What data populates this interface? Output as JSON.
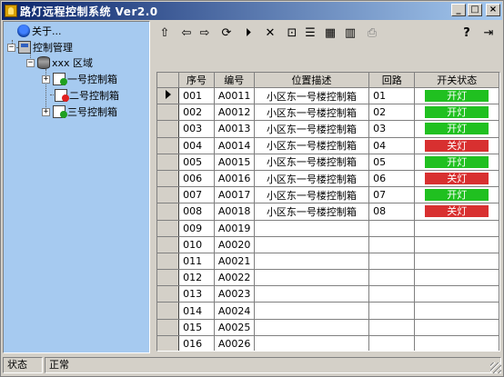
{
  "window": {
    "title": "路灯远程控制系统 Ver2.0",
    "controls": {
      "minimize": "_",
      "maximize": "□",
      "close": "×"
    }
  },
  "tree": {
    "about": "关于...",
    "control_mgmt": "控制管理",
    "area": "xxx 区域",
    "boxes": [
      {
        "label": "一号控制箱",
        "expander": "+",
        "status": "ok"
      },
      {
        "label": "二号控制箱",
        "expander": "",
        "status": "alert"
      },
      {
        "label": "三号控制箱",
        "expander": "+",
        "status": "ok"
      }
    ],
    "root_expander": "−",
    "area_expander": "−"
  },
  "toolbar": {
    "icons": [
      "folder-up-icon",
      "back-icon",
      "forward-icon",
      "refresh-icon",
      "skip-icon",
      "delete-icon",
      "properties-icon",
      "tree-view-icon",
      "grid-view-icon",
      "list-view-icon",
      "print-icon",
      "help-icon",
      "exit-icon"
    ],
    "glyphs": {
      "folder_up": "⇧",
      "back": "⇦",
      "forward": "⇨",
      "refresh": "⟳",
      "skip": "⏵",
      "delete": "✕",
      "properties": "⊡",
      "tree_view": "☰",
      "grid_view": "▦",
      "list_view": "▥",
      "print": "⎙",
      "help": "?",
      "exit": "⇥"
    }
  },
  "table": {
    "columns": [
      "序号",
      "编号",
      "位置描述",
      "回路",
      "开关状态"
    ],
    "rows": [
      {
        "seq": "001",
        "code": "A0011",
        "location": "小区东一号楼控制箱",
        "loop": "01",
        "state": "开灯",
        "state_type": "on",
        "current": true
      },
      {
        "seq": "002",
        "code": "A0012",
        "location": "小区东一号楼控制箱",
        "loop": "02",
        "state": "开灯",
        "state_type": "on"
      },
      {
        "seq": "003",
        "code": "A0013",
        "location": "小区东一号楼控制箱",
        "loop": "03",
        "state": "开灯",
        "state_type": "on"
      },
      {
        "seq": "004",
        "code": "A0014",
        "location": "小区东一号楼控制箱",
        "loop": "04",
        "state": "关灯",
        "state_type": "off"
      },
      {
        "seq": "005",
        "code": "A0015",
        "location": "小区东一号楼控制箱",
        "loop": "05",
        "state": "开灯",
        "state_type": "on"
      },
      {
        "seq": "006",
        "code": "A0016",
        "location": "小区东一号楼控制箱",
        "loop": "06",
        "state": "关灯",
        "state_type": "off"
      },
      {
        "seq": "007",
        "code": "A0017",
        "location": "小区东一号楼控制箱",
        "loop": "07",
        "state": "开灯",
        "state_type": "on"
      },
      {
        "seq": "008",
        "code": "A0018",
        "location": "小区东一号楼控制箱",
        "loop": "08",
        "state": "关灯",
        "state_type": "off"
      },
      {
        "seq": "009",
        "code": "A0019",
        "location": "",
        "loop": "",
        "state": "",
        "state_type": ""
      },
      {
        "seq": "010",
        "code": "A0020",
        "location": "",
        "loop": "",
        "state": "",
        "state_type": ""
      },
      {
        "seq": "011",
        "code": "A0021",
        "location": "",
        "loop": "",
        "state": "",
        "state_type": ""
      },
      {
        "seq": "012",
        "code": "A0022",
        "location": "",
        "loop": "",
        "state": "",
        "state_type": ""
      },
      {
        "seq": "013",
        "code": "A0023",
        "location": "",
        "loop": "",
        "state": "",
        "state_type": ""
      },
      {
        "seq": "014",
        "code": "A0024",
        "location": "",
        "loop": "",
        "state": "",
        "state_type": ""
      },
      {
        "seq": "015",
        "code": "A0025",
        "location": "",
        "loop": "",
        "state": "",
        "state_type": ""
      },
      {
        "seq": "016",
        "code": "A0026",
        "location": "",
        "loop": "",
        "state": "",
        "state_type": ""
      }
    ]
  },
  "status": {
    "label": "状态",
    "value": "正常"
  },
  "colors": {
    "on": "#20c020",
    "off": "#d83030",
    "tree_bg": "#a6caf0",
    "titlebar": "#0a246a"
  }
}
